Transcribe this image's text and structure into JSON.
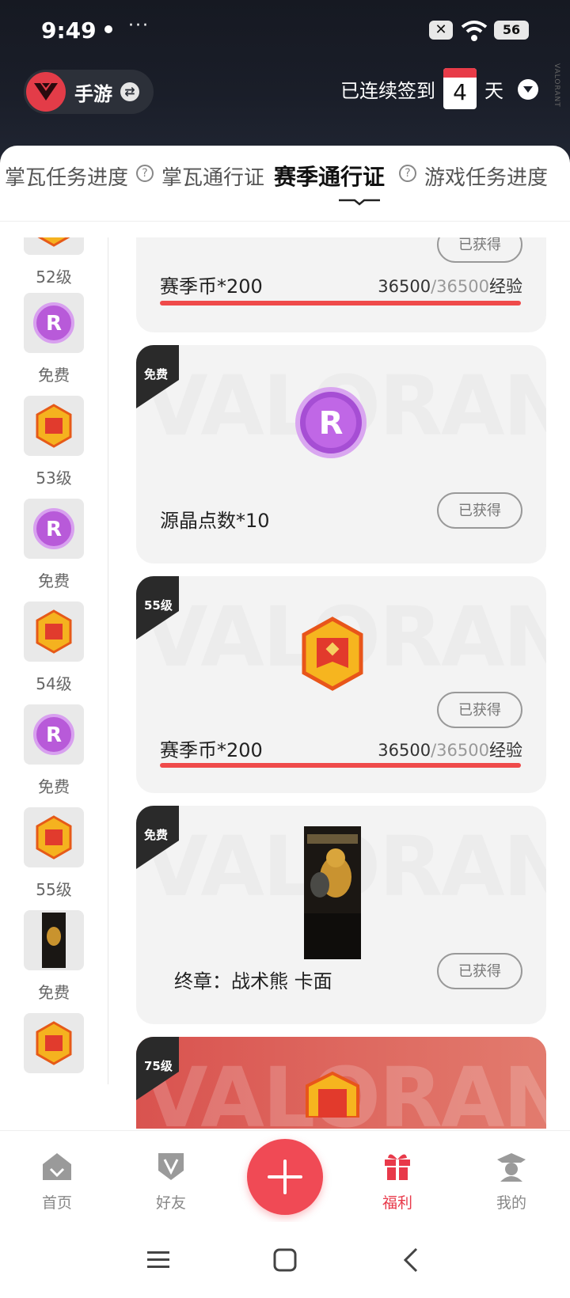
{
  "status_bar": {
    "time": "9:49",
    "more": "···",
    "x_badge": "✕",
    "battery": "56"
  },
  "header": {
    "app_name": "手游",
    "checkin_prefix": "已连续签到",
    "checkin_days": "4",
    "checkin_suffix": "天",
    "side_text": "VALORANT"
  },
  "tabs": [
    {
      "label": "掌瓦任务进度"
    },
    {
      "label": "掌瓦通行证"
    },
    {
      "label": "赛季通行证",
      "active": true
    },
    {
      "label": "游戏任务进度"
    }
  ],
  "left_list": [
    {
      "label": "52级",
      "icon": "season-coin-icon"
    },
    {
      "label": "免费",
      "icon": "radianite-icon"
    },
    {
      "label": "53级",
      "icon": "season-coin-icon"
    },
    {
      "label": "免费",
      "icon": "radianite-icon"
    },
    {
      "label": "54级",
      "icon": "season-coin-icon"
    },
    {
      "label": "免费",
      "icon": "radianite-icon"
    },
    {
      "label": "55级",
      "icon": "season-coin-icon"
    },
    {
      "label": "免费",
      "icon": "card-icon"
    },
    {
      "label": "",
      "icon": "season-coin-icon"
    }
  ],
  "cards": [
    {
      "corner": "",
      "name": "赛季币*200",
      "exp_current": "36500",
      "exp_max": "/36500",
      "exp_unit": "经验",
      "progress": 1.0,
      "button": "已获得"
    },
    {
      "corner": "免费",
      "name": "源晶点数*10",
      "button": "已获得"
    },
    {
      "corner": "55级",
      "name": "赛季币*200",
      "exp_current": "36500",
      "exp_max": "/36500",
      "exp_unit": "经验",
      "progress": 1.0,
      "button": "已获得"
    },
    {
      "corner": "免费",
      "name": "终章：战术熊 卡面",
      "button": "已获得"
    },
    {
      "corner": "75级",
      "name": ""
    }
  ],
  "watermark": "VALORANT",
  "bottom_nav": {
    "home": "首页",
    "friends": "好友",
    "benefits": "福利",
    "mine": "我的"
  },
  "colors": {
    "accent": "#e8394a",
    "progress": "#ef4a4a",
    "header_bg": "#1a1e29"
  }
}
